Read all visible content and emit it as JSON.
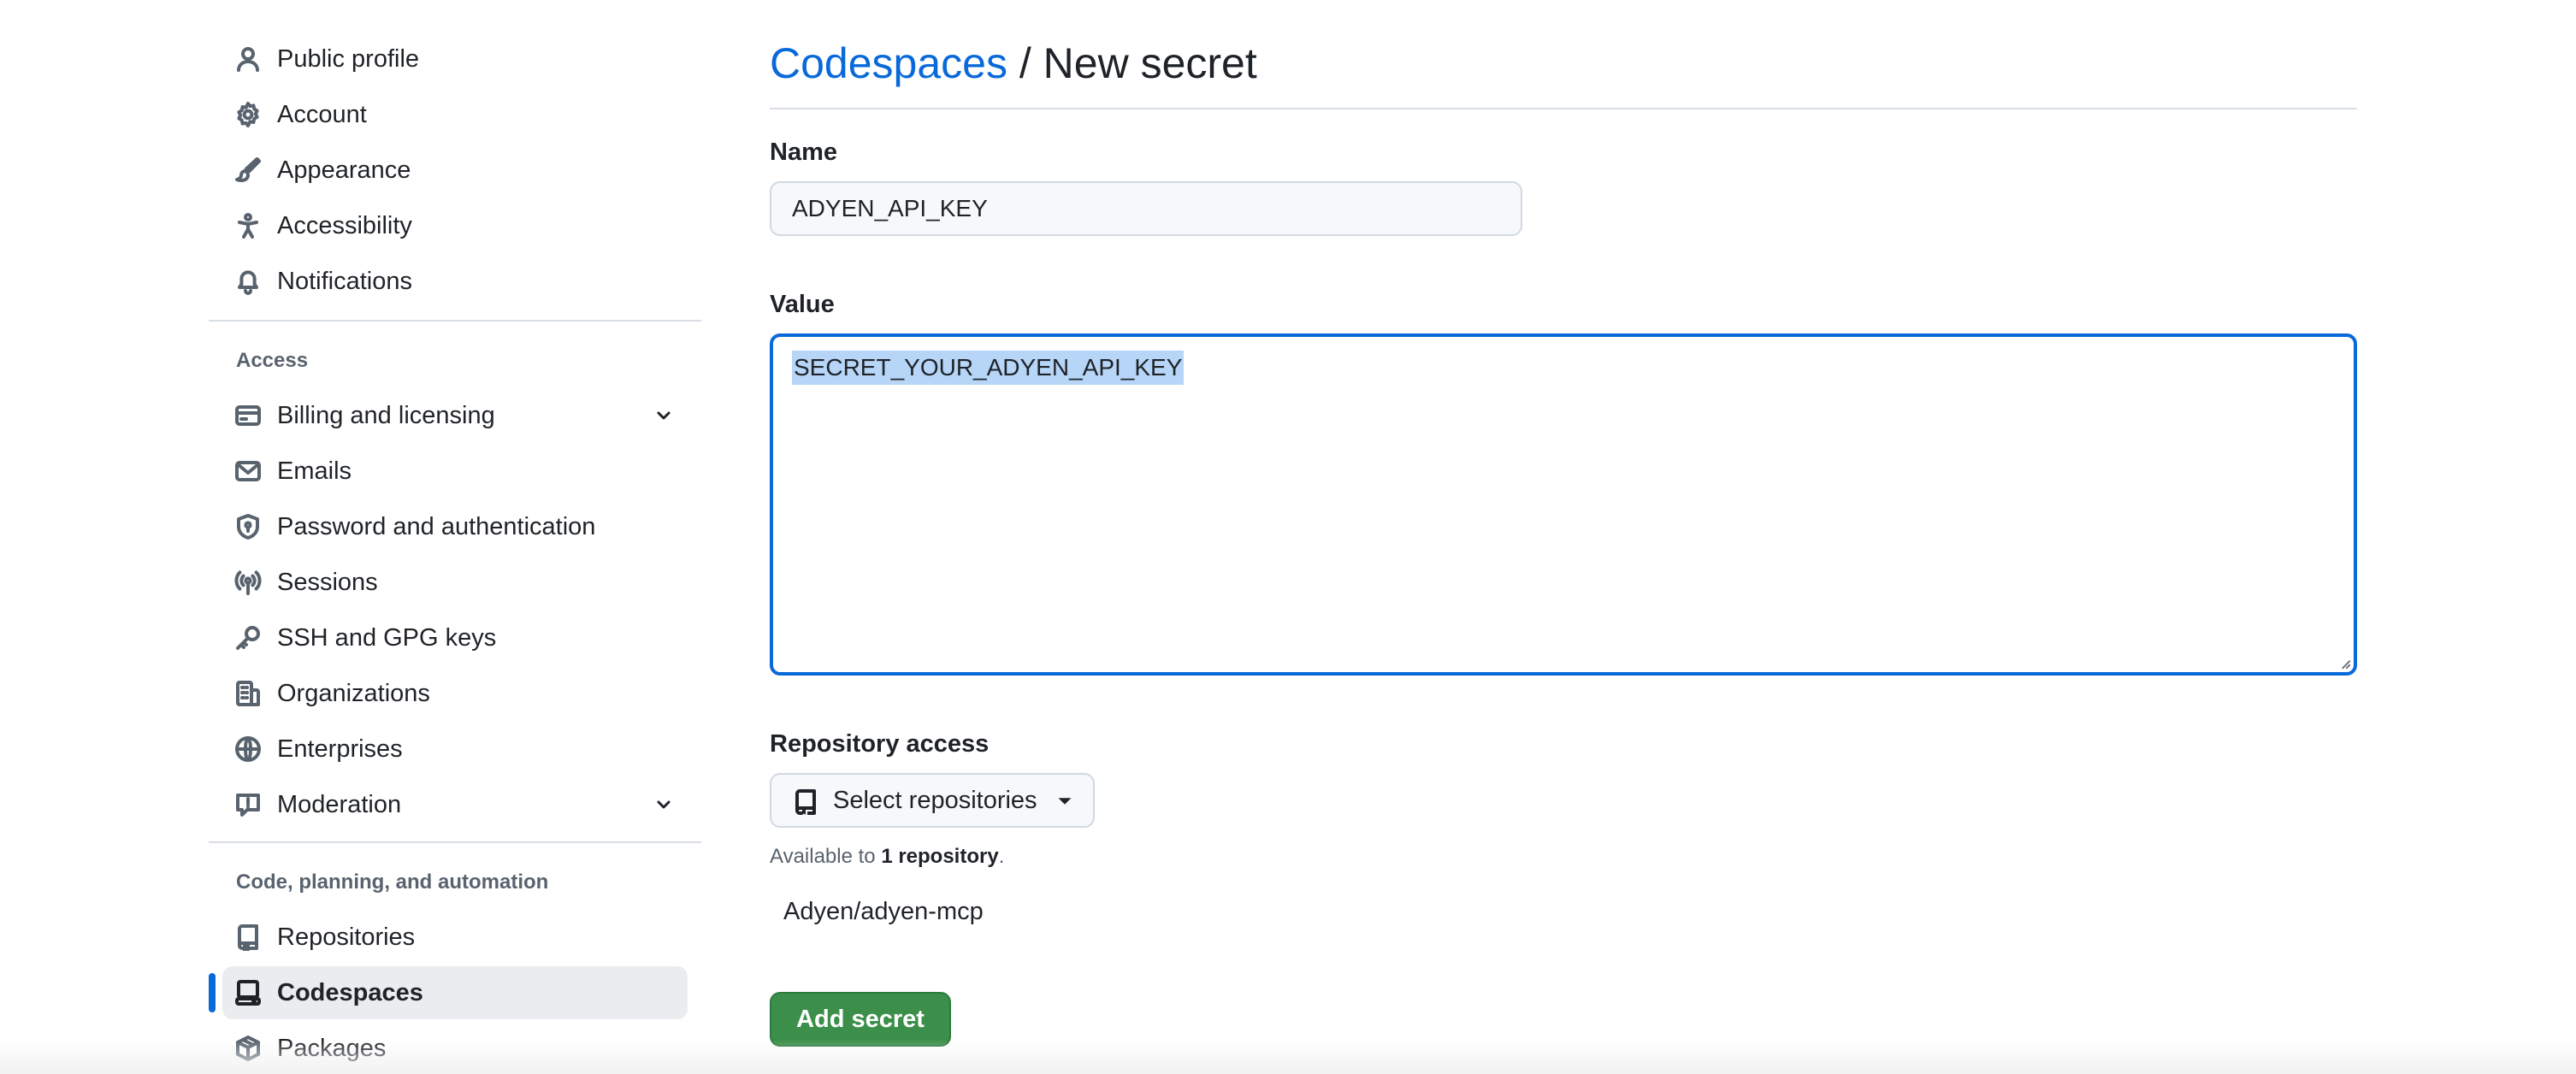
{
  "sidebar": {
    "top_items": [
      {
        "label": "Public profile",
        "icon": "person-icon"
      },
      {
        "label": "Account",
        "icon": "gear-icon"
      },
      {
        "label": "Appearance",
        "icon": "paintbrush-icon"
      },
      {
        "label": "Accessibility",
        "icon": "accessibility-icon"
      },
      {
        "label": "Notifications",
        "icon": "bell-icon"
      }
    ],
    "access_heading": "Access",
    "access_items": [
      {
        "label": "Billing and licensing",
        "icon": "credit-card-icon",
        "expandable": true
      },
      {
        "label": "Emails",
        "icon": "mail-icon"
      },
      {
        "label": "Password and authentication",
        "icon": "shield-lock-icon"
      },
      {
        "label": "Sessions",
        "icon": "broadcast-icon"
      },
      {
        "label": "SSH and GPG keys",
        "icon": "key-icon"
      },
      {
        "label": "Organizations",
        "icon": "organization-icon"
      },
      {
        "label": "Enterprises",
        "icon": "globe-icon"
      },
      {
        "label": "Moderation",
        "icon": "report-icon",
        "expandable": true
      }
    ],
    "code_heading": "Code, planning, and automation",
    "code_items": [
      {
        "label": "Repositories",
        "icon": "repo-icon"
      },
      {
        "label": "Codespaces",
        "icon": "codespaces-icon",
        "active": true
      },
      {
        "label": "Packages",
        "icon": "package-icon"
      }
    ]
  },
  "main": {
    "breadcrumb_link": "Codespaces",
    "breadcrumb_separator": " / ",
    "page_title": "New secret",
    "name_label": "Name",
    "name_value": "ADYEN_API_KEY",
    "value_label": "Value",
    "value_text": "SECRET_YOUR_ADYEN_API_KEY",
    "repo_access_label": "Repository access",
    "select_repos_label": "Select repositories",
    "available_prefix": "Available to ",
    "available_count": "1 repository",
    "available_suffix": ".",
    "selected_repo": "Adyen/adyen-mcp",
    "add_button": "Add secret"
  },
  "colors": {
    "accent": "#0969da",
    "primary_button": "#3c8f4a",
    "selection": "#b6d5f7"
  }
}
